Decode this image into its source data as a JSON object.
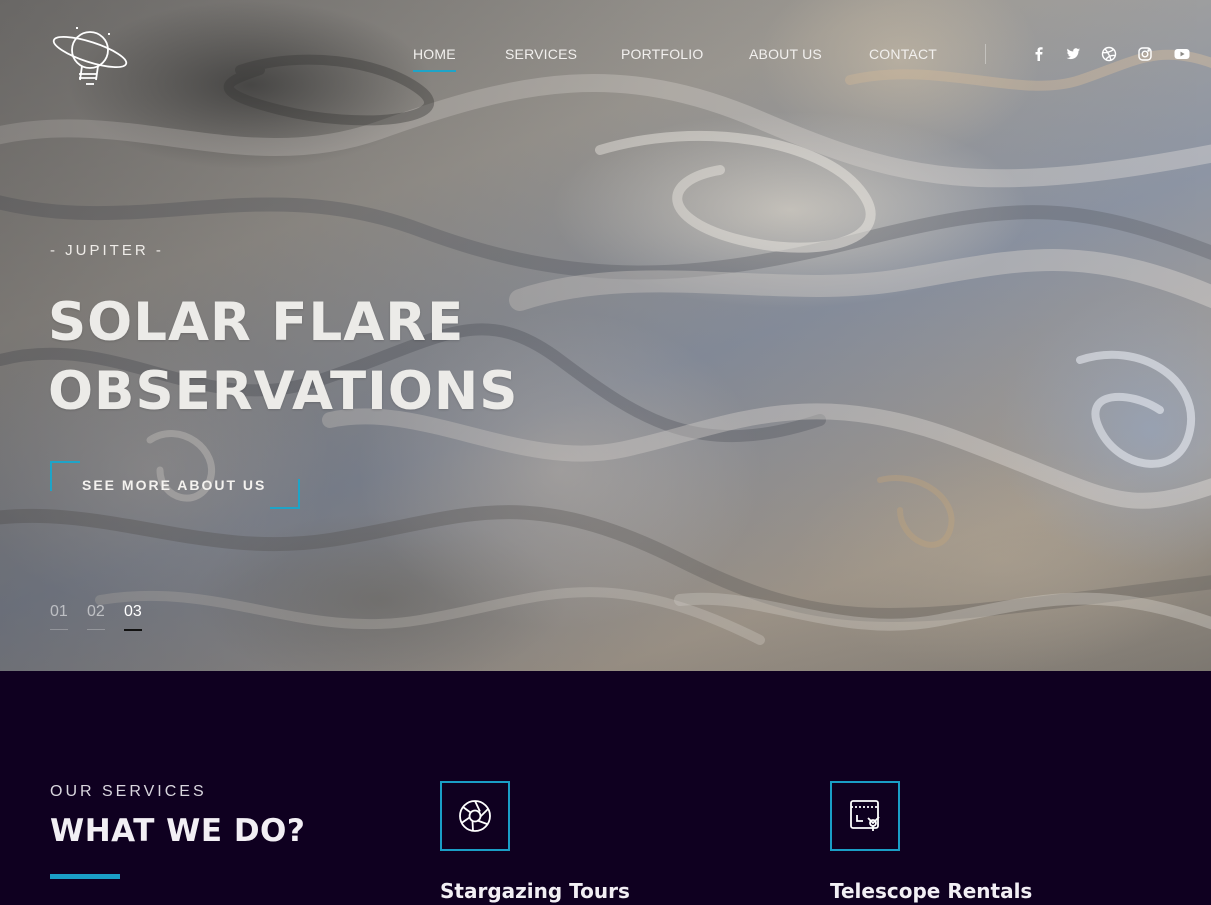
{
  "nav": {
    "items": [
      {
        "label": "HOME",
        "active": true
      },
      {
        "label": "SERVICES",
        "active": false
      },
      {
        "label": "PORTFOLIO",
        "active": false
      },
      {
        "label": "ABOUT US",
        "active": false
      },
      {
        "label": "CONTACT",
        "active": false
      }
    ]
  },
  "social": [
    "facebook-icon",
    "twitter-icon",
    "dribbble-icon",
    "instagram-icon",
    "youtube-icon"
  ],
  "hero": {
    "kicker": "- JUPITER -",
    "headline_line1": "SOLAR FLARE",
    "headline_line2": "OBSERVATIONS",
    "cta": "SEE MORE ABOUT US",
    "slides": [
      "01",
      "02",
      "03"
    ],
    "active_slide": "03"
  },
  "services": {
    "kicker": "OUR SERVICES",
    "title": "WHAT WE DO?",
    "items": [
      {
        "name": "Stargazing Tours",
        "icon": "aperture-icon"
      },
      {
        "name": "Telescope Rentals",
        "icon": "screen-cursor-icon"
      }
    ]
  },
  "colors": {
    "accent": "#1ea4c8",
    "dark_bg": "#0f0020",
    "text_light": "#ecebe8"
  }
}
